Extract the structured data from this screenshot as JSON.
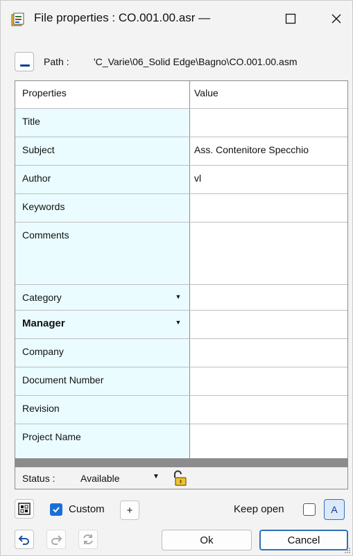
{
  "window": {
    "title": "File properties : CO.001.00.asr —",
    "min_glyph": "—",
    "max_glyph": "☐",
    "close_glyph": "✕"
  },
  "path": {
    "label": "Path :",
    "value": "'C_Varie\\06_Solid Edge\\Bagno\\CO.001.00.asm"
  },
  "table": {
    "col_property": "Properties",
    "col_value": "Value",
    "rows": [
      {
        "name": "Title",
        "value": ""
      },
      {
        "name": "Subject",
        "value": "Ass. Contenitore Specchio"
      },
      {
        "name": "Author",
        "value": "vl"
      },
      {
        "name": "Keywords",
        "value": ""
      },
      {
        "name": "Comments",
        "value": ""
      },
      {
        "name": "Category",
        "value": ""
      },
      {
        "name": "Manager",
        "value": ""
      },
      {
        "name": "Company",
        "value": ""
      },
      {
        "name": "Document Number",
        "value": ""
      },
      {
        "name": "Revision",
        "value": ""
      },
      {
        "name": "Project Name",
        "value": ""
      }
    ]
  },
  "status": {
    "label": "Status :",
    "value": "Available"
  },
  "toolbar": {
    "custom_label": "Custom",
    "custom_checked": true,
    "plus_label": "+",
    "keep_open_label": "Keep open",
    "keep_open_checked": false,
    "a_label": "A",
    "ok_label": "Ok",
    "cancel_label": "Cancel"
  },
  "colors": {
    "accent": "#1a6fd6",
    "property_cell_bg": "#eafcff",
    "grid_border": "#8c8c8c"
  }
}
